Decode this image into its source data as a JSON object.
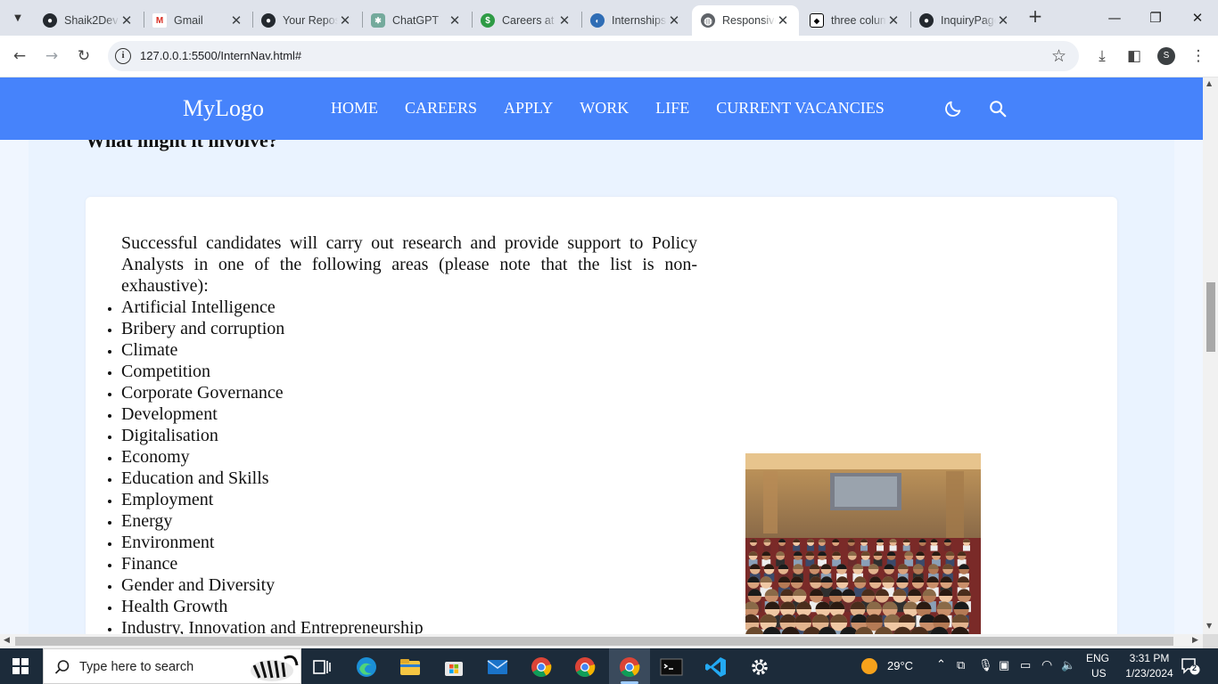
{
  "browser": {
    "tabs": [
      {
        "title": "Shaik2Dev",
        "favicon": "github-icon",
        "active": false
      },
      {
        "title": "Gmail",
        "favicon": "gmail-icon",
        "active": false
      },
      {
        "title": "Your Repositories",
        "favicon": "github-icon",
        "active": false
      },
      {
        "title": "ChatGPT",
        "favicon": "chatgpt-icon",
        "active": false
      },
      {
        "title": "Careers at",
        "favicon": "careers-icon",
        "active": false
      },
      {
        "title": "Internships",
        "favicon": "oecd-icon",
        "active": false
      },
      {
        "title": "Responsive",
        "favicon": "globe-icon",
        "active": true
      },
      {
        "title": "three columns",
        "favicon": "codepen-icon",
        "active": false
      },
      {
        "title": "InquiryPage",
        "favicon": "github-icon",
        "active": false
      }
    ],
    "url": "127.0.0.1:5500/InternNav.html#",
    "profile_initial": "S"
  },
  "site": {
    "logo": "MyLogo",
    "nav": [
      "HOME",
      "CAREERS",
      "APPLY",
      "WORK",
      "LIFE",
      "CURRENT VACANCIES"
    ],
    "section_heading": "What might it involve?",
    "intro": "Successful candidates will carry out research and provide support to Policy Analysts in one of the following areas (please note that the list is non-exhaustive):",
    "areas": [
      "Artificial Intelligence",
      "Bribery and corruption",
      "Climate",
      "Competition",
      "Corporate Governance",
      "Development",
      "Digitalisation",
      "Economy",
      "Education and Skills",
      "Employment",
      "Energy",
      "Environment",
      "Finance",
      "Gender and Diversity",
      "Health Growth",
      "Industry, Innovation and Entrepreneurship"
    ],
    "colors": {
      "nav_bg": "#4683fb",
      "page_bg": "#eaf3ff"
    }
  },
  "taskbar": {
    "search_placeholder": "Type here to search",
    "weather": "29°C",
    "language": "ENG",
    "region": "US",
    "time": "3:31 PM",
    "date": "1/23/2024",
    "notifications": "2"
  }
}
